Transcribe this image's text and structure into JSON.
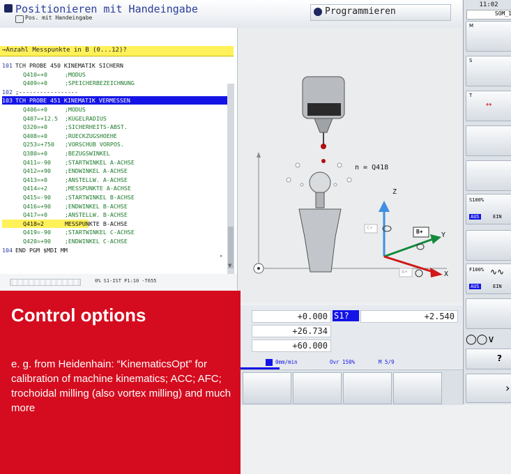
{
  "header": {
    "mode_title": "Positionieren mit Handeingabe",
    "mode_subtitle": "Pos. mit Handeingabe",
    "programming_title": "Programmieren",
    "clock": "11:02",
    "som_label": "SOM_1"
  },
  "program": {
    "prompt": "→Anzahl Messpunkte in B (0...12)?",
    "lines": [
      {
        "num": "101",
        "text": "TCH PROBE 450 KINEMATIK SICHERN",
        "kind": "block"
      },
      {
        "num": "",
        "text": "Q410=+0     ;MODUS",
        "kind": "param"
      },
      {
        "num": "",
        "text": "Q409=+0     ;SPEICHERBEZEICHNUNG",
        "kind": "param"
      },
      {
        "num": "102",
        "text": ";-----------------",
        "kind": "block"
      },
      {
        "num": "103",
        "text": "TCH PROBE 451 KINEMATIK VERMESSEN",
        "kind": "active"
      },
      {
        "num": "",
        "text": "Q406=+0     ;MODUS",
        "kind": "param"
      },
      {
        "num": "",
        "text": "Q407=+12.5  ;KUGELRADIUS",
        "kind": "param"
      },
      {
        "num": "",
        "text": "Q320=+0     ;SICHERHEITS-ABST.",
        "kind": "param"
      },
      {
        "num": "",
        "text": "Q408=+0     ;RUECKZUGSHOEHE",
        "kind": "param"
      },
      {
        "num": "",
        "text": "Q253=+750   ;VORSCHUB VORPOS.",
        "kind": "param"
      },
      {
        "num": "",
        "text": "Q380=+0     ;BEZUGSWINKEL",
        "kind": "param"
      },
      {
        "num": "",
        "text": "Q411=-90    ;STARTWINKEL A-ACHSE",
        "kind": "param"
      },
      {
        "num": "",
        "text": "Q412=+90    ;ENDWINKEL A-ACHSE",
        "kind": "param"
      },
      {
        "num": "",
        "text": "Q413=+0     ;ANSTELLW. A-ACHSE",
        "kind": "param"
      },
      {
        "num": "",
        "text": "Q414=+2     ;MESSPUNKTE A-ACHSE",
        "kind": "param"
      },
      {
        "num": "",
        "text": "Q415=-90    ;STARTWINKEL B-ACHSE",
        "kind": "param"
      },
      {
        "num": "",
        "text": "Q416=+90    ;ENDWINKEL B-ACHSE",
        "kind": "param"
      },
      {
        "num": "",
        "text": "Q417=+0     ;ANSTELLW. B-ACHSE",
        "kind": "param"
      },
      {
        "num": "",
        "text": "Q418=2      MESSPUNKTE B-ACHSE",
        "kind": "edit"
      },
      {
        "num": "",
        "text": "Q419=-90    ;STARTWINKEL C-ACHSE",
        "kind": "param"
      },
      {
        "num": "",
        "text": "Q420=+90    ;ENDWINKEL C-ACHSE",
        "kind": "param"
      },
      {
        "num": "104",
        "text": "END PGM $MDI MM",
        "kind": "block"
      }
    ],
    "status": "0% S1-IST   P1:10   -T655"
  },
  "graphic": {
    "n_label": "n = Q418",
    "axis_z": "Z",
    "axis_y": "Y",
    "axis_x": "X",
    "c_label": "C+",
    "b_label": "B+",
    "a_label": "A+"
  },
  "position_display": {
    "values": [
      "+0.000",
      "+26.734",
      "+60.000"
    ],
    "s_label": "S1?",
    "s_value": "+2.540",
    "feed": "0mm/min",
    "override": "Ovr 150%",
    "m_code": "M 5/9"
  },
  "softkeys": {
    "s_override": "S100%",
    "f_override": "F100%",
    "aus": "AUS",
    "ein": "EIN",
    "help": "?"
  },
  "card": {
    "title": "Control options",
    "body": "e. g. from Heidenhain: “KinematicsOpt” for calibration of machine kinematics; ACC; AFC; trochoidal milling (also vortex milling) and much more"
  },
  "colors": {
    "card_red": "#d50c1f",
    "active_line_blue": "#1414e6",
    "prompt_yellow": "#fff15a",
    "comment_green": "#1c7a2a"
  }
}
